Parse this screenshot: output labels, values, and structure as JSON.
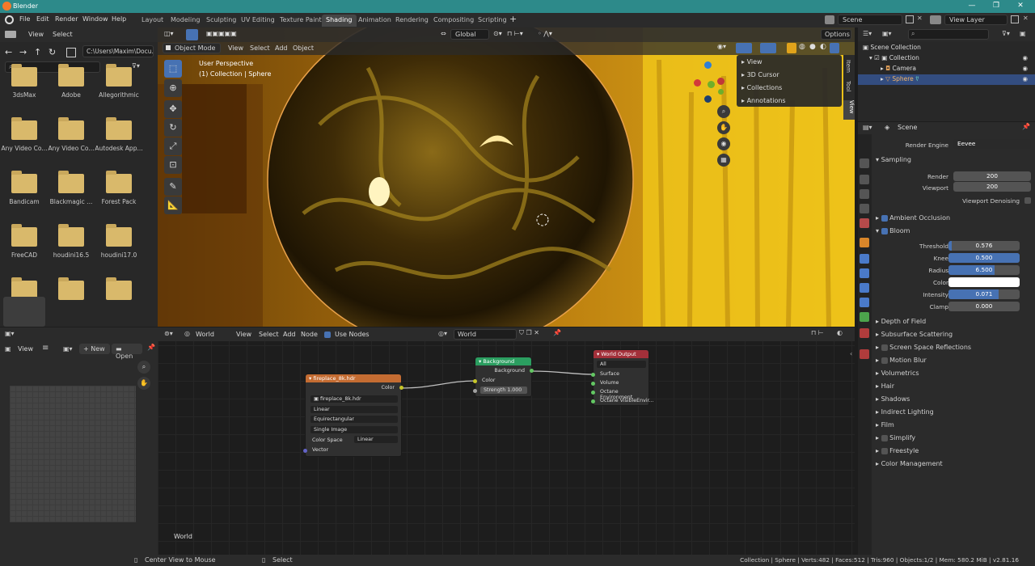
{
  "window": {
    "title": "Blender",
    "min": "—",
    "max": "❐",
    "close": "✕"
  },
  "menubar": {
    "items": [
      "File",
      "Edit",
      "Render",
      "Window",
      "Help"
    ],
    "workspaces": [
      "Layout",
      "Modeling",
      "Sculpting",
      "UV Editing",
      "Texture Paint",
      "Shading",
      "Animation",
      "Rendering",
      "Compositing",
      "Scripting"
    ],
    "active_workspace": "Shading",
    "add": "+",
    "scene": "Scene",
    "view_layer": "View Layer"
  },
  "filebrowser": {
    "view": "View",
    "select": "Select",
    "path": "C:\\Users\\Maxim\\Docu...",
    "folders": [
      "3dsMax",
      "Adobe",
      "Allegorithmic",
      "Any Video Co...",
      "Any Video Co...",
      "Autodesk App...",
      "Bandicam",
      "Blackmagic ...",
      "Forest Pack",
      "FreeCAD",
      "houdini16.5",
      "houdini17.0",
      "",
      "",
      ""
    ]
  },
  "viewport": {
    "mode": "Object Mode",
    "view": "View",
    "select": "Select",
    "add": "Add",
    "object": "Object",
    "orientation": "Global",
    "options": "Options",
    "perspective": "User Perspective",
    "collection": "(1) Collection | Sphere",
    "popup": [
      "View",
      "3D Cursor",
      "Collections",
      "Annotations"
    ],
    "side_tabs": [
      "Item",
      "Tool",
      "View"
    ]
  },
  "image_editor": {
    "view": "View",
    "new": "New",
    "open": "Open"
  },
  "node_editor": {
    "editor": "World",
    "view": "View",
    "select": "Select",
    "add": "Add",
    "node": "Node",
    "use_nodes": "Use Nodes",
    "world": "World",
    "label": "World",
    "env": {
      "title": "fireplace_8k.hdr",
      "out": "Color",
      "image": "fireplace_8k.hdr",
      "interp": "Linear",
      "proj": "Equirectangular",
      "src": "Single Image",
      "cs_label": "Color Space",
      "cs": "Linear",
      "vector": "Vector"
    },
    "bg": {
      "title": "Background",
      "out": "Background",
      "color": "Color",
      "strength_label": "Strength",
      "strength": "1.000"
    },
    "out": {
      "title": "World Output",
      "target": "All",
      "surface": "Surface",
      "volume": "Volume",
      "oct_env": "Octane Environment",
      "oct_vis": "Octane VisibleEnvir..."
    }
  },
  "outliner": {
    "root": "Scene Collection",
    "items": [
      "Collection",
      "Camera",
      "Sphere"
    ]
  },
  "properties": {
    "scene": "Scene",
    "engine_label": "Render Engine",
    "engine": "Eevee",
    "sampling": "Sampling",
    "render_label": "Render",
    "render": "200",
    "viewport_label": "Viewport",
    "viewport": "200",
    "denoise": "Viewport Denoising",
    "ao": "Ambient Occlusion",
    "bloom": "Bloom",
    "bloom_fields": [
      {
        "label": "Threshold",
        "value": "0.576",
        "fill": 0.04
      },
      {
        "label": "Knee",
        "value": "0.500",
        "fill": 1
      },
      {
        "label": "Radius",
        "value": "6.500",
        "fill": 0.65
      },
      {
        "label": "Color",
        "value": "",
        "fill": 0
      },
      {
        "label": "Intensity",
        "value": "0.071",
        "fill": 0.7
      },
      {
        "label": "Clamp",
        "value": "0.000",
        "fill": 0
      }
    ],
    "sections": [
      "Depth of Field",
      "Subsurface Scattering",
      "Screen Space Reflections",
      "Motion Blur",
      "Volumetrics",
      "Hair",
      "Shadows",
      "Indirect Lighting",
      "Film",
      "Simplify",
      "Freestyle",
      "Color Management"
    ]
  },
  "statusbar": {
    "left": "Center View to Mouse",
    "mid": "Select",
    "right": "Collection | Sphere | Verts:482 | Faces:512 | Tris:960 | Objects:1/2 | Mem: 580.2 MiB | v2.81.16"
  }
}
